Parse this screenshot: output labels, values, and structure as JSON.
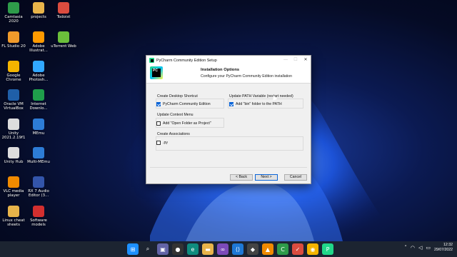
{
  "desktop": {
    "icons": [
      {
        "label": "Camtasia 2020",
        "color": "#2e9b4a"
      },
      {
        "label": "projects",
        "color": "#e8b44a"
      },
      {
        "label": "Todoist",
        "color": "#db4c3f"
      },
      {
        "label": "FL Studio 20",
        "color": "#f09a2b"
      },
      {
        "label": "Adobe Illustrat...",
        "color": "#ff9a00"
      },
      {
        "label": "uTorrent Web",
        "color": "#6bbf3b"
      },
      {
        "label": "Google Chrome",
        "color": "#f4b400"
      },
      {
        "label": "Adobe Photosh...",
        "color": "#31a8ff"
      },
      {
        "label": "Oracle VM VirtualBox",
        "color": "#1f5fa8"
      },
      {
        "label": "Internet Downlo...",
        "color": "#1f9e4b"
      },
      {
        "label": "Unity 2021.2.19f1",
        "color": "#dddddd"
      },
      {
        "label": "MEmu",
        "color": "#2d7cd6"
      },
      {
        "label": "Unity Hub",
        "color": "#dddddd"
      },
      {
        "label": "Multi-MEmu",
        "color": "#2d7cd6"
      },
      {
        "label": "VLC media player",
        "color": "#f08a00"
      },
      {
        "label": "RX 7 Audio Editor (3...",
        "color": "#3355aa"
      },
      {
        "label": "Linux cheat sheets",
        "color": "#e8b44a"
      },
      {
        "label": "Software models",
        "color": "#d32f2f"
      }
    ]
  },
  "dialog": {
    "title": "PyCharm Community Edition Setup",
    "window_controls": {
      "minimize": "—",
      "maximize": "☐",
      "close": "✕"
    },
    "logo_text": "PC",
    "header_title": "Installation Options",
    "header_subtitle": "Configure your PyCharm Community Edition installation",
    "groups": {
      "shortcut_title": "Create Desktop Shortcut",
      "shortcut_option": "PyCharm Community Edition",
      "shortcut_checked": true,
      "path_title": "Update PATH Variable (restart needed)",
      "path_option": "Add \"bin\" folder to the PATH",
      "path_checked": true,
      "context_title": "Update Context Menu",
      "context_option": "Add \"Open Folder as Project\"",
      "context_checked": false,
      "assoc_title": "Create Associations",
      "assoc_option": ".py",
      "assoc_checked": false
    },
    "buttons": {
      "back": "< Back",
      "next": "Next >",
      "cancel": "Cancel"
    }
  },
  "taskbar": {
    "apps": [
      {
        "name": "windows-start",
        "glyph": "⊞",
        "color": "#1e90ff"
      },
      {
        "name": "search",
        "glyph": "⌕",
        "color": "#1c2431"
      },
      {
        "name": "chat",
        "glyph": "▣",
        "color": "#6264a7"
      },
      {
        "name": "camera",
        "glyph": "●",
        "color": "#333"
      },
      {
        "name": "edge",
        "glyph": "e",
        "color": "#0f8c7e"
      },
      {
        "name": "file-explorer",
        "glyph": "▬",
        "color": "#e8b44a"
      },
      {
        "name": "visual-studio",
        "glyph": "∞",
        "color": "#7b4ab8"
      },
      {
        "name": "vscode",
        "glyph": "⟨⟩",
        "color": "#1e78d6"
      },
      {
        "name": "unity",
        "glyph": "◆",
        "color": "#444"
      },
      {
        "name": "vlc",
        "glyph": "▲",
        "color": "#f08a00"
      },
      {
        "name": "camtasia",
        "glyph": "C",
        "color": "#2e9b4a"
      },
      {
        "name": "todoist",
        "glyph": "✓",
        "color": "#db4c3f"
      },
      {
        "name": "chrome",
        "glyph": "◉",
        "color": "#f4b400"
      },
      {
        "name": "pycharm",
        "glyph": "P",
        "color": "#21d789"
      }
    ],
    "time": "12:32",
    "date": "29/07/2022"
  }
}
